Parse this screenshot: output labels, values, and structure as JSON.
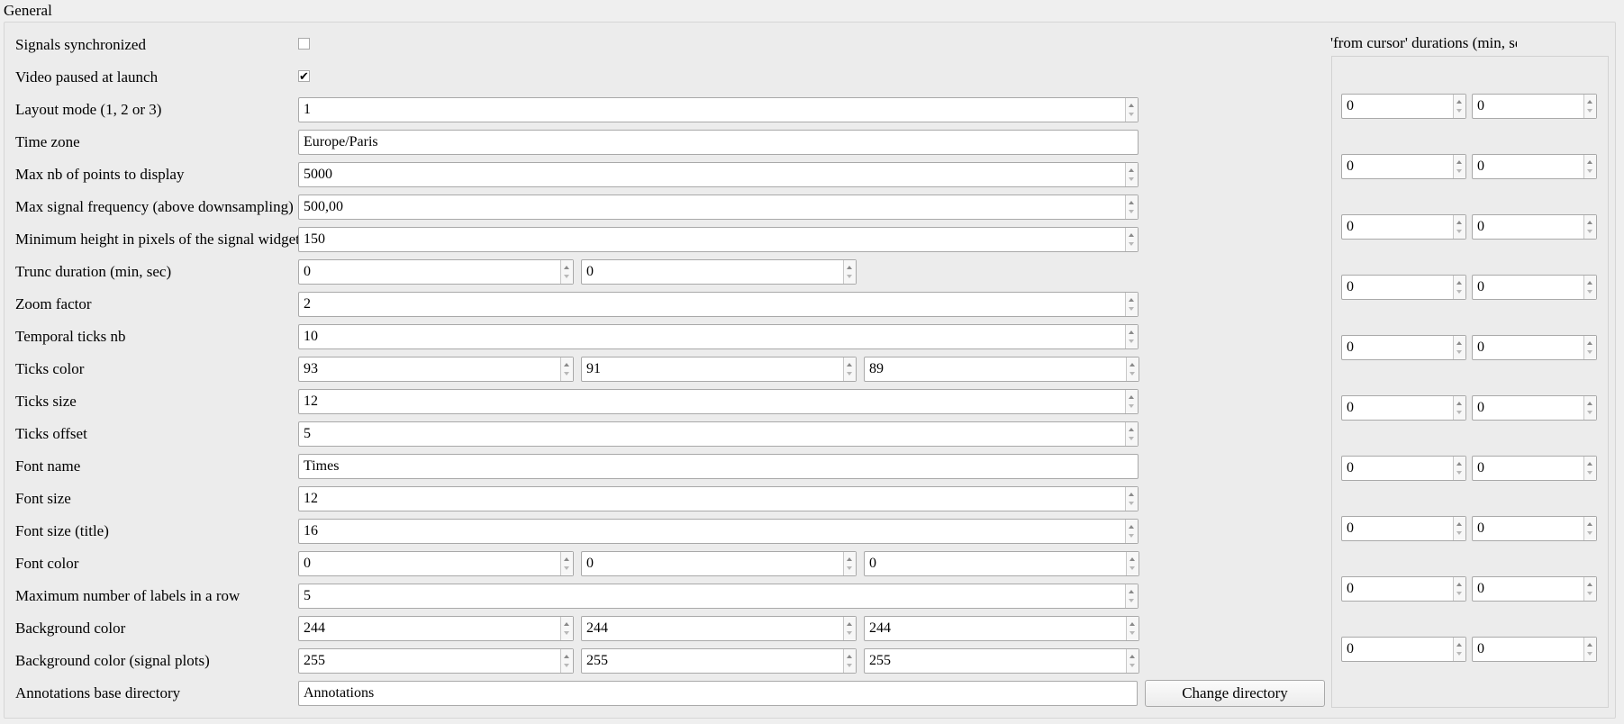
{
  "group_title": "General",
  "fields": [
    {
      "id": "sync",
      "label": "Signals synchronized",
      "type": "checkbox",
      "checked": false
    },
    {
      "id": "paused",
      "label": "Video paused at launch",
      "type": "checkbox",
      "checked": true,
      "checkmark": "✔"
    },
    {
      "id": "layout",
      "label": "Layout mode (1, 2 or 3)",
      "type": "spin",
      "values": [
        "1"
      ]
    },
    {
      "id": "tz",
      "label": "Time zone",
      "type": "text",
      "values": [
        "Europe/Paris"
      ]
    },
    {
      "id": "maxpts",
      "label": "Max nb of points to display",
      "type": "spin",
      "values": [
        "5000"
      ]
    },
    {
      "id": "maxfreq",
      "label": "Max signal frequency (above downsampling)",
      "type": "spin",
      "values": [
        "500,00"
      ]
    },
    {
      "id": "minh",
      "label": "Minimum height in pixels of the signal widgets",
      "type": "spin",
      "values": [
        "150"
      ]
    },
    {
      "id": "trunc",
      "label": "Trunc duration (min, sec)",
      "type": "spin2",
      "values": [
        "0",
        "0"
      ]
    },
    {
      "id": "zoom",
      "label": "Zoom factor",
      "type": "spin",
      "values": [
        "2"
      ]
    },
    {
      "id": "tticks",
      "label": "Temporal ticks nb",
      "type": "spin",
      "values": [
        "10"
      ]
    },
    {
      "id": "tcolor",
      "label": "Ticks color",
      "type": "spin3",
      "values": [
        "93",
        "91",
        "89"
      ]
    },
    {
      "id": "tsize",
      "label": "Ticks size",
      "type": "spin",
      "values": [
        "12"
      ]
    },
    {
      "id": "toffset",
      "label": "Ticks offset",
      "type": "spin",
      "values": [
        "5"
      ]
    },
    {
      "id": "fname",
      "label": "Font name",
      "type": "text",
      "values": [
        "Times"
      ]
    },
    {
      "id": "fsize",
      "label": "Font size",
      "type": "spin",
      "values": [
        "12"
      ]
    },
    {
      "id": "fsizet",
      "label": "Font size (title)",
      "type": "spin",
      "values": [
        "16"
      ]
    },
    {
      "id": "fcolor",
      "label": "Font color",
      "type": "spin3",
      "values": [
        "0",
        "0",
        "0"
      ]
    },
    {
      "id": "maxlabels",
      "label": "Maximum number of labels in a row",
      "type": "spin",
      "values": [
        "5"
      ]
    },
    {
      "id": "bgcolor",
      "label": "Background color",
      "type": "spin3",
      "values": [
        "244",
        "244",
        "244"
      ]
    },
    {
      "id": "bgcolorsig",
      "label": "Background color (signal plots)",
      "type": "spin3",
      "values": [
        "255",
        "255",
        "255"
      ]
    },
    {
      "id": "annot",
      "label": "Annotations base directory",
      "type": "text_button",
      "values": [
        "Annotations"
      ],
      "button": "Change directory"
    }
  ],
  "cursor_durations": {
    "title": "'from cursor' durations (min, sec)",
    "rows": [
      [
        "0",
        "0"
      ],
      [
        "0",
        "0"
      ],
      [
        "0",
        "0"
      ],
      [
        "0",
        "0"
      ],
      [
        "0",
        "0"
      ],
      [
        "0",
        "0"
      ],
      [
        "0",
        "0"
      ],
      [
        "0",
        "0"
      ],
      [
        "0",
        "0"
      ],
      [
        "0",
        "0"
      ]
    ]
  }
}
